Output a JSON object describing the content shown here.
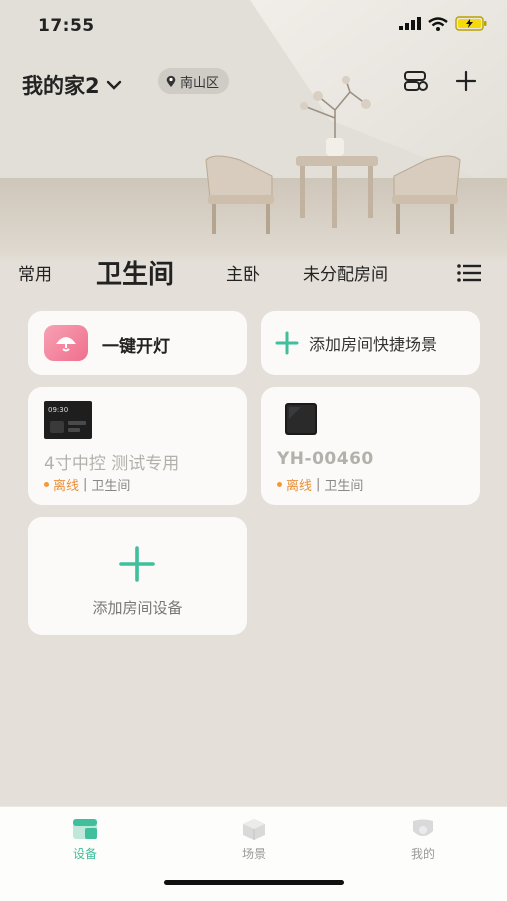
{
  "status_bar": {
    "time": "17:55"
  },
  "header": {
    "home_name": "我的家2",
    "location": "南山区"
  },
  "tabs": [
    {
      "label": "常用"
    },
    {
      "label": "卫生间"
    },
    {
      "label": "主卧"
    },
    {
      "label": "未分配房间"
    }
  ],
  "scene_card": {
    "label": "一键开灯"
  },
  "add_scene_card": {
    "label": "添加房间快捷场景"
  },
  "devices": [
    {
      "name": "4寸中控 测试专用",
      "status": "离线",
      "room": "卫生间",
      "screen_time": "09:30"
    },
    {
      "name": "YH-00460",
      "status": "离线",
      "room": "卫生间"
    }
  ],
  "add_device_card": {
    "label": "添加房间设备"
  },
  "bottom_nav": [
    {
      "label": "设备"
    },
    {
      "label": "场景"
    },
    {
      "label": "我的"
    }
  ],
  "colors": {
    "accent": "#3fbf9b",
    "offline": "#e8913a",
    "scene_icon": "#ef6f8e"
  }
}
